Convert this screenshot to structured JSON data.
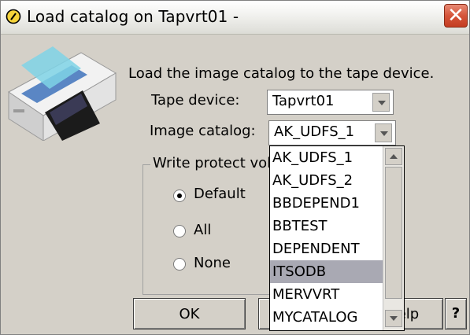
{
  "window": {
    "title": "Load catalog on Tapvrt01 -"
  },
  "icons": {
    "app": "info-disc-icon",
    "close": "close-icon",
    "illustration": "tape-device-icon"
  },
  "colors": {
    "window_bg": "#d4d0c8",
    "close_button": "#d5543a",
    "selection": "#a9a9b3"
  },
  "main": {
    "prompt": "Load the image catalog to the tape device.",
    "tape_device": {
      "label": "Tape device:",
      "value": "Tapvrt01"
    },
    "image_catalog": {
      "label": "Image catalog:",
      "value": "AK_UDFS_1",
      "options": [
        "AK_UDFS_1",
        "AK_UDFS_2",
        "BBDEPEND1",
        "BBTEST",
        "DEPENDENT",
        "ITSODB",
        "MERVVRT",
        "MYCATALOG"
      ],
      "highlighted": "ITSODB"
    },
    "write_protect": {
      "title": "Write protect vol",
      "options": [
        {
          "label": "Default",
          "selected": true
        },
        {
          "label": "All",
          "selected": false
        },
        {
          "label": "None",
          "selected": false
        }
      ]
    }
  },
  "buttons": {
    "ok": "OK",
    "help": "elp",
    "question": "?"
  }
}
